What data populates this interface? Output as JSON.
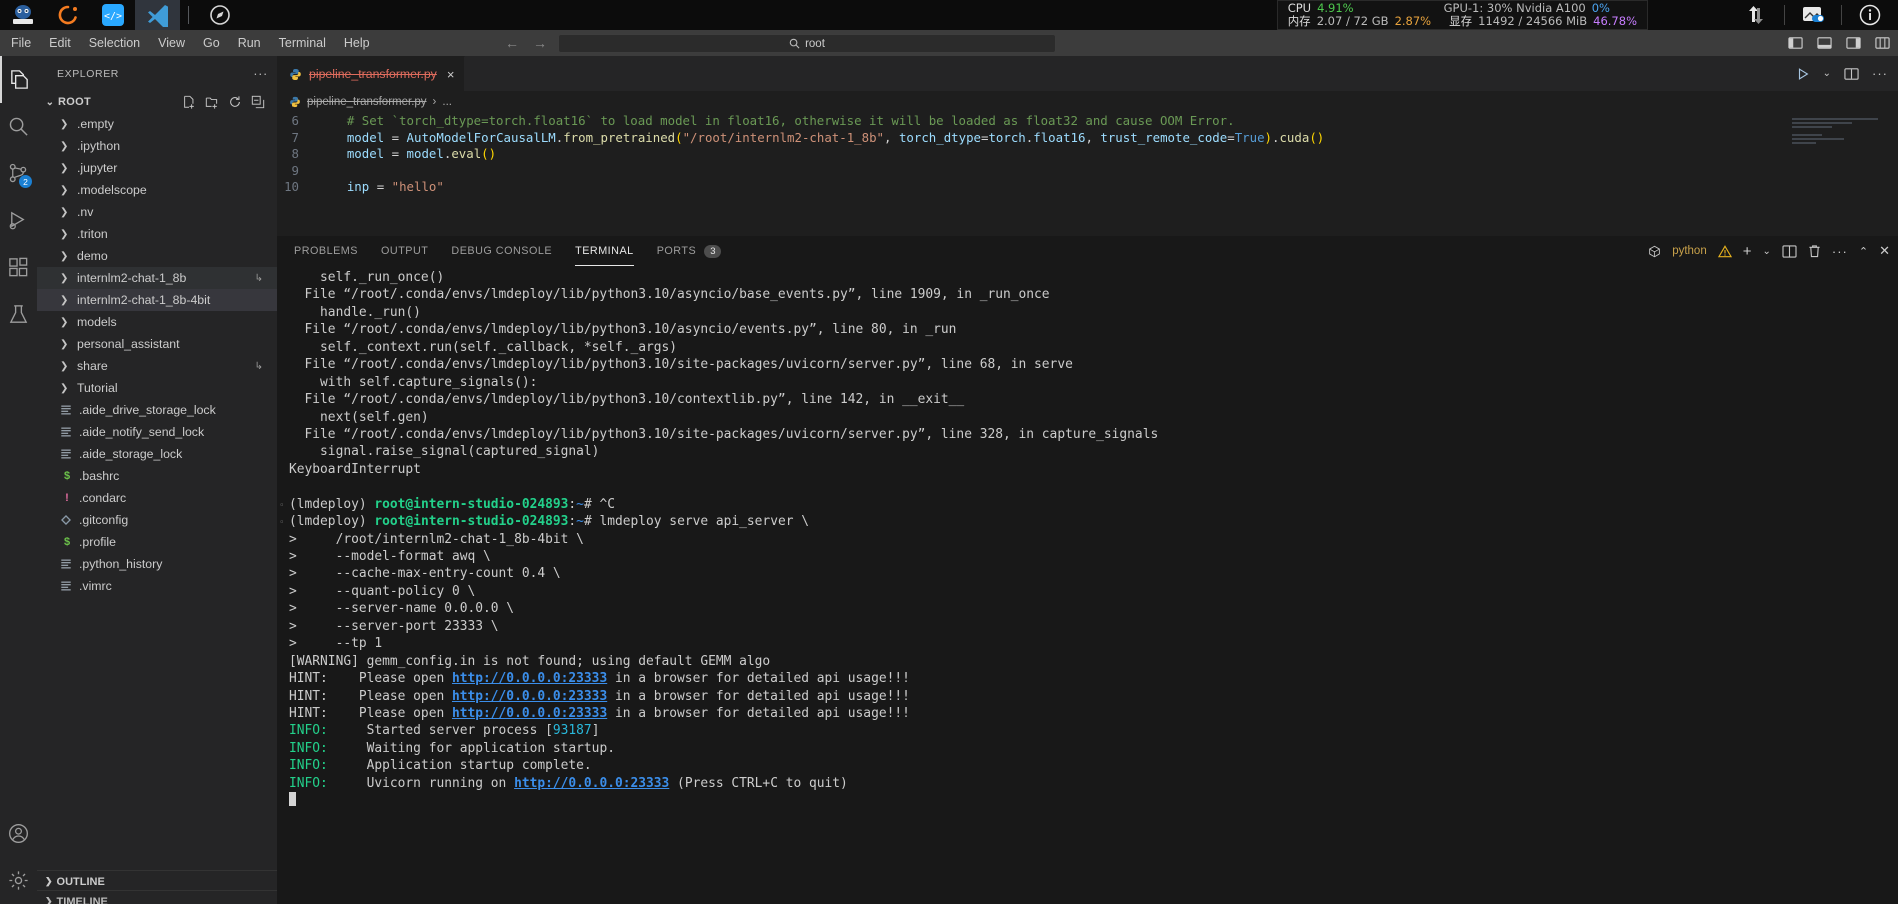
{
  "os_bar": {
    "apps": [
      {
        "name": "jupyter-app",
        "label": ""
      },
      {
        "name": "conda-app",
        "label": ""
      },
      {
        "name": "code-server-app",
        "label": ""
      },
      {
        "name": "vscode-app",
        "label": ""
      },
      {
        "name": "compass-app",
        "label": ""
      }
    ],
    "stats": {
      "cpu_label": "CPU",
      "cpu_value": "4.91%",
      "mem_label": "内存",
      "mem_value": "2.07 / 72 GB",
      "mem_pct": "2.87%",
      "gpu_label": "GPU-1: 30% Nvidia A100",
      "gpu_pct": "0%",
      "vram_label": "显存",
      "vram_value": "11492 / 24566 MiB",
      "vram_pct": "46.78%"
    },
    "right_icons": [
      "transfer-icon",
      "screenshot-toggle-icon",
      "info-icon"
    ]
  },
  "menubar": {
    "items": [
      "File",
      "Edit",
      "Selection",
      "View",
      "Go",
      "Run",
      "Terminal",
      "Help"
    ],
    "nav_back": "←",
    "nav_forward": "→"
  },
  "quick_input": {
    "value": "root",
    "icon": "search-icon"
  },
  "window_controls": [
    "toggle-primary-sidebar-icon",
    "toggle-panel-icon",
    "toggle-secondary-sidebar-icon",
    "customize-layout-icon"
  ],
  "activitybar": {
    "items": [
      {
        "name": "explorer",
        "icon": "files-icon",
        "selected": true,
        "badge": ""
      },
      {
        "name": "search",
        "icon": "search-icon",
        "selected": false,
        "badge": ""
      },
      {
        "name": "source-control",
        "icon": "source-control-icon",
        "selected": false,
        "badge": "2"
      },
      {
        "name": "run-and-debug",
        "icon": "debug-icon",
        "selected": false,
        "badge": ""
      },
      {
        "name": "extensions",
        "icon": "extensions-icon",
        "selected": false,
        "badge": ""
      },
      {
        "name": "testing",
        "icon": "beaker-icon",
        "selected": false,
        "badge": ""
      }
    ],
    "bottom_items": [
      {
        "name": "accounts",
        "icon": "account-icon"
      },
      {
        "name": "settings",
        "icon": "gear-icon"
      }
    ]
  },
  "sidebar": {
    "title": "EXPLORER",
    "more_actions": "···",
    "root_label": "ROOT",
    "root_actions": [
      "new-file-icon",
      "new-folder-icon",
      "refresh-icon",
      "collapse-all-icon"
    ],
    "files": [
      {
        "label": ".empty",
        "type": "folder",
        "state": "",
        "link": false
      },
      {
        "label": ".ipython",
        "type": "folder",
        "state": "",
        "link": false
      },
      {
        "label": ".jupyter",
        "type": "folder",
        "state": "",
        "link": false
      },
      {
        "label": ".modelscope",
        "type": "folder",
        "state": "",
        "link": false
      },
      {
        "label": ".nv",
        "type": "folder",
        "state": "",
        "link": false
      },
      {
        "label": ".triton",
        "type": "folder",
        "state": "",
        "link": false
      },
      {
        "label": "demo",
        "type": "folder",
        "state": "",
        "link": false
      },
      {
        "label": "internlm2-chat-1_8b",
        "type": "folder",
        "state": "hl",
        "link": true
      },
      {
        "label": "internlm2-chat-1_8b-4bit",
        "type": "folder",
        "state": "sel",
        "link": false
      },
      {
        "label": "models",
        "type": "folder",
        "state": "",
        "link": false
      },
      {
        "label": "personal_assistant",
        "type": "folder",
        "state": "",
        "link": false
      },
      {
        "label": "share",
        "type": "folder",
        "state": "",
        "link": true
      },
      {
        "label": "Tutorial",
        "type": "folder",
        "state": "",
        "link": false
      },
      {
        "label": ".aide_drive_storage_lock",
        "type": "text",
        "state": "",
        "link": false
      },
      {
        "label": ".aide_notify_send_lock",
        "type": "text",
        "state": "",
        "link": false
      },
      {
        "label": ".aide_storage_lock",
        "type": "text",
        "state": "",
        "link": false
      },
      {
        "label": ".bashrc",
        "type": "shell",
        "state": "",
        "link": false
      },
      {
        "label": ".condarc",
        "type": "config",
        "state": "",
        "link": false
      },
      {
        "label": ".gitconfig",
        "type": "git",
        "state": "",
        "link": false
      },
      {
        "label": ".profile",
        "type": "shell",
        "state": "",
        "link": false
      },
      {
        "label": ".python_history",
        "type": "text",
        "state": "",
        "link": false
      },
      {
        "label": ".vimrc",
        "type": "text",
        "state": "",
        "link": false
      }
    ],
    "outline_label": "OUTLINE",
    "timeline_label": "TIMELINE"
  },
  "editor": {
    "tab": {
      "filename": "pipeline_transformer.py",
      "icon": "python-file-icon",
      "close": "×"
    },
    "actions": [
      "run-python-file-icon",
      "chevron-down-icon",
      "split-editor-icon",
      "more-actions-icon"
    ],
    "breadcrumb": {
      "file": "pipeline_transformer.py",
      "separator": "›",
      "symbol": "..."
    },
    "code_lines": [
      {
        "num": "6",
        "segments": [
          {
            "t": "    # Set `torch_dtype=torch.float16` to load model in float16, otherwise it will be loaded as float32 and cause OOM Error.",
            "c": "tok-cmt"
          }
        ]
      },
      {
        "num": "7",
        "segments": [
          {
            "t": "    ",
            "c": "tok-op"
          },
          {
            "t": "model",
            "c": "tok-var"
          },
          {
            "t": " = ",
            "c": "tok-op"
          },
          {
            "t": "AutoModelForCausalLM",
            "c": "tok-var"
          },
          {
            "t": ".",
            "c": "tok-op"
          },
          {
            "t": "from_pretrained",
            "c": "tok-fn"
          },
          {
            "t": "(",
            "c": "tok-par"
          },
          {
            "t": "\"/root/internlm2-chat-1_8b\"",
            "c": "tok-str"
          },
          {
            "t": ", ",
            "c": "tok-op"
          },
          {
            "t": "torch_dtype",
            "c": "tok-var"
          },
          {
            "t": "=",
            "c": "tok-op"
          },
          {
            "t": "torch",
            "c": "tok-var"
          },
          {
            "t": ".",
            "c": "tok-op"
          },
          {
            "t": "float16",
            "c": "tok-var"
          },
          {
            "t": ", ",
            "c": "tok-op"
          },
          {
            "t": "trust_remote_code",
            "c": "tok-var"
          },
          {
            "t": "=",
            "c": "tok-op"
          },
          {
            "t": "True",
            "c": "tok-kw"
          },
          {
            "t": ")",
            "c": "tok-par"
          },
          {
            "t": ".",
            "c": "tok-op"
          },
          {
            "t": "cuda",
            "c": "tok-fn"
          },
          {
            "t": "()",
            "c": "tok-par"
          }
        ]
      },
      {
        "num": "8",
        "segments": [
          {
            "t": "    ",
            "c": "tok-op"
          },
          {
            "t": "model",
            "c": "tok-var"
          },
          {
            "t": " = ",
            "c": "tok-op"
          },
          {
            "t": "model",
            "c": "tok-var"
          },
          {
            "t": ".",
            "c": "tok-op"
          },
          {
            "t": "eval",
            "c": "tok-fn"
          },
          {
            "t": "()",
            "c": "tok-par"
          }
        ]
      },
      {
        "num": "9",
        "segments": [
          {
            "t": "",
            "c": "tok-op"
          }
        ]
      },
      {
        "num": "10",
        "segments": [
          {
            "t": "    ",
            "c": "tok-op"
          },
          {
            "t": "inp",
            "c": "tok-var"
          },
          {
            "t": " = ",
            "c": "tok-op"
          },
          {
            "t": "\"hello\"",
            "c": "tok-str"
          }
        ]
      }
    ]
  },
  "panel": {
    "tabs": [
      {
        "label": "PROBLEMS",
        "active": false,
        "badge": ""
      },
      {
        "label": "OUTPUT",
        "active": false,
        "badge": ""
      },
      {
        "label": "DEBUG CONSOLE",
        "active": false,
        "badge": ""
      },
      {
        "label": "TERMINAL",
        "active": true,
        "badge": ""
      },
      {
        "label": "PORTS",
        "active": false,
        "badge": "3"
      }
    ],
    "terminal_name": "python",
    "actions": [
      "warning-icon",
      "new-terminal-icon",
      "chevron-down-icon",
      "split-terminal-icon",
      "kill-terminal-icon",
      "more-actions-icon",
      "maximize-panel-icon",
      "close-panel-icon"
    ],
    "terminal_lines": [
      {
        "prompt": false,
        "segments": [
          {
            "t": "    self._run_once()",
            "c": ""
          }
        ]
      },
      {
        "prompt": false,
        "segments": [
          {
            "t": "  File “/root/.conda/envs/lmdeploy/lib/python3.10/asyncio/base_events.py”, line 1909, in _run_once",
            "c": ""
          }
        ]
      },
      {
        "prompt": false,
        "segments": [
          {
            "t": "    handle._run()",
            "c": ""
          }
        ]
      },
      {
        "prompt": false,
        "segments": [
          {
            "t": "  File “/root/.conda/envs/lmdeploy/lib/python3.10/asyncio/events.py”, line 80, in _run",
            "c": ""
          }
        ]
      },
      {
        "prompt": false,
        "segments": [
          {
            "t": "    self._context.run(self._callback, *self._args)",
            "c": ""
          }
        ]
      },
      {
        "prompt": false,
        "segments": [
          {
            "t": "  File “/root/.conda/envs/lmdeploy/lib/python3.10/site-packages/uvicorn/server.py”, line 68, in serve",
            "c": ""
          }
        ]
      },
      {
        "prompt": false,
        "segments": [
          {
            "t": "    with self.capture_signals():",
            "c": ""
          }
        ]
      },
      {
        "prompt": false,
        "segments": [
          {
            "t": "  File “/root/.conda/envs/lmdeploy/lib/python3.10/contextlib.py”, line 142, in __exit__",
            "c": ""
          }
        ]
      },
      {
        "prompt": false,
        "segments": [
          {
            "t": "    next(self.gen)",
            "c": ""
          }
        ]
      },
      {
        "prompt": false,
        "segments": [
          {
            "t": "  File “/root/.conda/envs/lmdeploy/lib/python3.10/site-packages/uvicorn/server.py”, line 328, in capture_signals",
            "c": ""
          }
        ]
      },
      {
        "prompt": false,
        "segments": [
          {
            "t": "    signal.raise_signal(captured_signal)",
            "c": ""
          }
        ]
      },
      {
        "prompt": false,
        "segments": [
          {
            "t": "KeyboardInterrupt",
            "c": ""
          }
        ]
      },
      {
        "prompt": false,
        "segments": [
          {
            "t": "",
            "c": ""
          }
        ]
      },
      {
        "prompt": true,
        "segments": [
          {
            "t": "(lmdeploy) ",
            "c": ""
          },
          {
            "t": "root@intern-studio-024893",
            "c": "t-green"
          },
          {
            "t": ":",
            "c": ""
          },
          {
            "t": "~",
            "c": "t-blue"
          },
          {
            "t": "# ^C",
            "c": ""
          }
        ]
      },
      {
        "prompt": true,
        "segments": [
          {
            "t": "(lmdeploy) ",
            "c": ""
          },
          {
            "t": "root@intern-studio-024893",
            "c": "t-green"
          },
          {
            "t": ":",
            "c": ""
          },
          {
            "t": "~",
            "c": "t-blue"
          },
          {
            "t": "# lmdeploy serve api_server \\",
            "c": ""
          }
        ]
      },
      {
        "prompt": false,
        "segments": [
          {
            "t": ">     /root/internlm2-chat-1_8b-4bit \\",
            "c": ""
          }
        ]
      },
      {
        "prompt": false,
        "segments": [
          {
            "t": ">     --model-format awq \\",
            "c": ""
          }
        ]
      },
      {
        "prompt": false,
        "segments": [
          {
            "t": ">     --cache-max-entry-count 0.4 \\",
            "c": ""
          }
        ]
      },
      {
        "prompt": false,
        "segments": [
          {
            "t": ">     --quant-policy 0 \\",
            "c": ""
          }
        ]
      },
      {
        "prompt": false,
        "segments": [
          {
            "t": ">     --server-name 0.0.0.0 \\",
            "c": ""
          }
        ]
      },
      {
        "prompt": false,
        "segments": [
          {
            "t": ">     --server-port 23333 \\",
            "c": ""
          }
        ]
      },
      {
        "prompt": false,
        "segments": [
          {
            "t": ">     --tp 1",
            "c": ""
          }
        ]
      },
      {
        "prompt": false,
        "segments": [
          {
            "t": "[WARNING] gemm_config.in is not found; using default GEMM algo",
            "c": ""
          }
        ]
      },
      {
        "prompt": false,
        "segments": [
          {
            "t": "HINT:    Please open ",
            "c": ""
          },
          {
            "t": "http://0.0.0.0:23333",
            "c": "t-link"
          },
          {
            "t": " in a browser for detailed api usage!!!",
            "c": ""
          }
        ]
      },
      {
        "prompt": false,
        "segments": [
          {
            "t": "HINT:    Please open ",
            "c": ""
          },
          {
            "t": "http://0.0.0.0:23333",
            "c": "t-link"
          },
          {
            "t": " in a browser for detailed api usage!!!",
            "c": ""
          }
        ]
      },
      {
        "prompt": false,
        "segments": [
          {
            "t": "HINT:    Please open ",
            "c": ""
          },
          {
            "t": "http://0.0.0.0:23333",
            "c": "t-link"
          },
          {
            "t": " in a browser for detailed api usage!!!",
            "c": ""
          }
        ]
      },
      {
        "prompt": false,
        "segments": [
          {
            "t": "INFO:",
            "c": "t-ok"
          },
          {
            "t": "     Started server process [",
            "c": ""
          },
          {
            "t": "93187",
            "c": "t-num"
          },
          {
            "t": "]",
            "c": ""
          }
        ]
      },
      {
        "prompt": false,
        "segments": [
          {
            "t": "INFO:",
            "c": "t-ok"
          },
          {
            "t": "     Waiting for application startup.",
            "c": ""
          }
        ]
      },
      {
        "prompt": false,
        "segments": [
          {
            "t": "INFO:",
            "c": "t-ok"
          },
          {
            "t": "     Application startup complete.",
            "c": ""
          }
        ]
      },
      {
        "prompt": false,
        "segments": [
          {
            "t": "INFO:",
            "c": "t-ok"
          },
          {
            "t": "     Uvicorn running on ",
            "c": ""
          },
          {
            "t": "http://0.0.0.0:23333",
            "c": "t-link"
          },
          {
            "t": " (Press CTRL+C to quit)",
            "c": ""
          }
        ]
      }
    ]
  },
  "colors": {
    "accent_blue": "#1b80d3",
    "terminal_green": "#23d18b",
    "terminal_link": "#3b8eea",
    "tab_deleted": "#e06c5d",
    "editor_bg": "#1e1e1e",
    "sidebar_bg": "#252526"
  }
}
